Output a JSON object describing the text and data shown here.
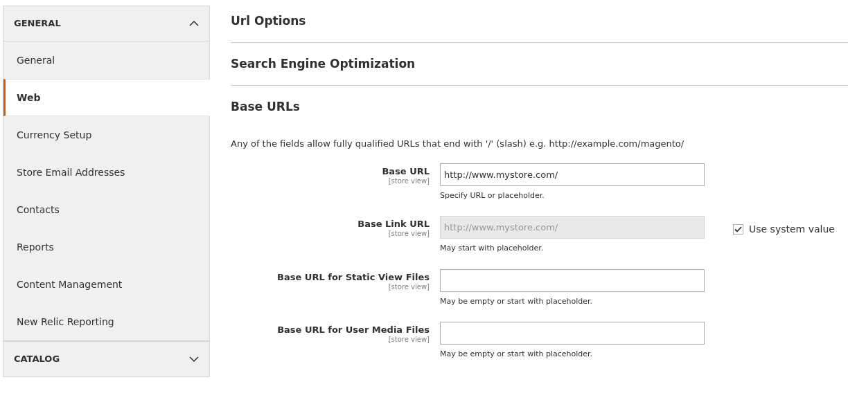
{
  "sidebar": {
    "groups": [
      {
        "title": "GENERAL",
        "expanded": true,
        "items": [
          {
            "label": "General",
            "selected": false
          },
          {
            "label": "Web",
            "selected": true
          },
          {
            "label": "Currency Setup",
            "selected": false
          },
          {
            "label": "Store Email Addresses",
            "selected": false
          },
          {
            "label": "Contacts",
            "selected": false
          },
          {
            "label": "Reports",
            "selected": false
          },
          {
            "label": "Content Management",
            "selected": false
          },
          {
            "label": "New Relic Reporting",
            "selected": false
          }
        ]
      },
      {
        "title": "CATALOG",
        "expanded": false
      }
    ]
  },
  "sections": [
    {
      "title": "Url Options"
    },
    {
      "title": "Search Engine Optimization"
    },
    {
      "title": "Base URLs",
      "description": "Any of the fields allow fully qualified URLs that end with '/' (slash) e.g. http://example.com/magento/",
      "fields": [
        {
          "label": "Base URL",
          "scope": "[store view]",
          "value": "http://www.mystore.com/",
          "disabled": false,
          "hint": "Specify URL or placeholder."
        },
        {
          "label": "Base Link URL",
          "scope": "[store view]",
          "value": "http://www.mystore.com/",
          "disabled": true,
          "hint": "May start with placeholder.",
          "system_value": {
            "label": "Use system value",
            "checked": true
          }
        },
        {
          "label": "Base URL for Static View Files",
          "scope": "[store view]",
          "disabled": false,
          "hint": "May be empty or start with placeholder."
        },
        {
          "label": "Base URL for User Media Files",
          "scope": "[store view]",
          "disabled": false,
          "hint": "May be empty or start with placeholder."
        }
      ]
    }
  ]
}
